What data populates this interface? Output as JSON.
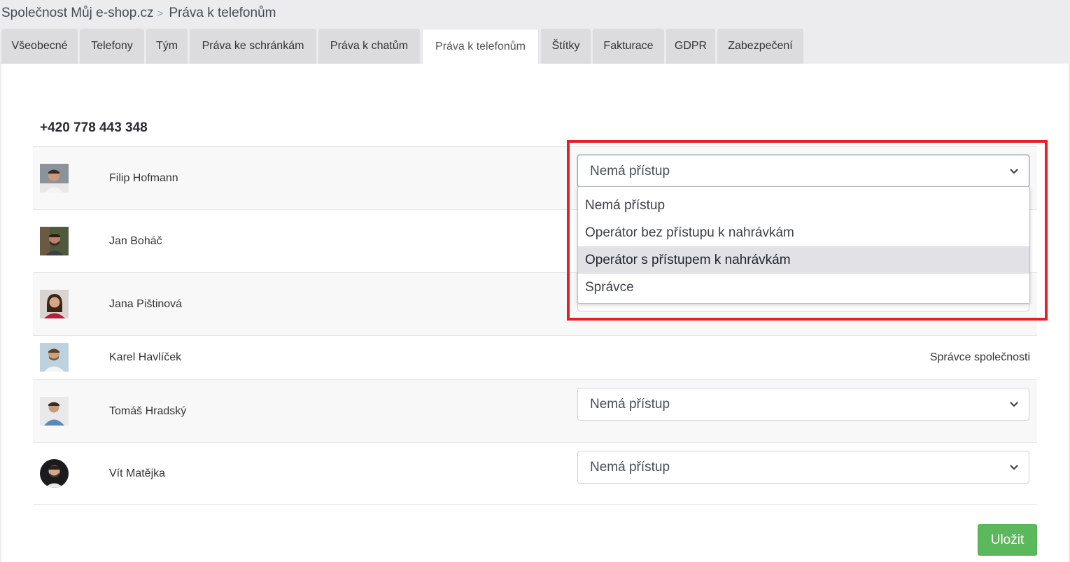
{
  "breadcrumb": {
    "parent": "Společnost Můj e-shop.cz",
    "separator": ">",
    "current": "Práva k telefonům"
  },
  "tabs": [
    {
      "label": "Všeobecné",
      "active": false
    },
    {
      "label": "Telefony",
      "active": false
    },
    {
      "label": "Tým",
      "active": false
    },
    {
      "label": "Práva ke schránkám",
      "active": false
    },
    {
      "label": "Práva k chatům",
      "active": false
    },
    {
      "label": "Práva k telefonům",
      "active": true
    },
    {
      "label": "Štítky",
      "active": false
    },
    {
      "label": "Fakturace",
      "active": false
    },
    {
      "label": "GDPR",
      "active": false
    },
    {
      "label": "Zabezpečení",
      "active": false
    }
  ],
  "phone_number": "+420 778 443 348",
  "users": [
    {
      "name": "Filip Hofmann",
      "access": "Nemá přístup",
      "control": "select-open"
    },
    {
      "name": "Jan Boháč",
      "access": "",
      "control": "select-hidden"
    },
    {
      "name": "Jana Pištinová",
      "access": "",
      "control": "select-hidden"
    },
    {
      "name": "Karel Havlíček",
      "access": "Správce společnosti",
      "control": "static"
    },
    {
      "name": "Tomáš Hradský",
      "access": "Nemá přístup",
      "control": "select"
    },
    {
      "name": "Vít Matějka",
      "access": "Nemá přístup",
      "control": "select"
    }
  ],
  "dropdown": {
    "options": [
      "Nemá přístup",
      "Operátor bez přístupu k nahrávkám",
      "Operátor s přístupem k nahrávkám",
      "Správce"
    ],
    "highlighted": "Operátor s přístupem k nahrávkám"
  },
  "save_label": "Uložit",
  "colors": {
    "save_button": "#5cb85c",
    "highlight_box": "#e3202a",
    "tab_inactive": "#dcdcdf",
    "page_background": "#ececee"
  }
}
